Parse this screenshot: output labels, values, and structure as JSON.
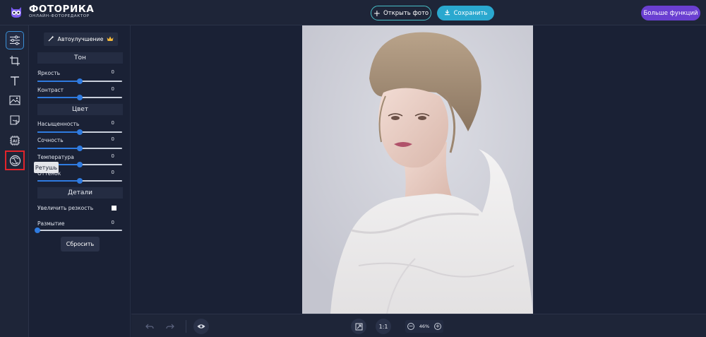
{
  "brand": {
    "name": "ФОТОРИКА",
    "subtitle": "ОНЛАЙН-ФОТОРЕДАКТОР"
  },
  "header": {
    "open_label": "Открыть фото",
    "save_label": "Сохранить",
    "more_label": "Больше функций"
  },
  "toolbar": {
    "tools": [
      {
        "name": "adjust",
        "icon": "sliders-icon",
        "active": true
      },
      {
        "name": "crop",
        "icon": "crop-icon"
      },
      {
        "name": "text",
        "icon": "text-icon"
      },
      {
        "name": "image",
        "icon": "image-icon"
      },
      {
        "name": "sticker",
        "icon": "sticker-icon"
      },
      {
        "name": "ai",
        "icon": "ai-chip-icon"
      },
      {
        "name": "retouch",
        "icon": "retouch-icon",
        "highlighted": true
      }
    ],
    "tooltip": "Ретушь"
  },
  "panel": {
    "auto_label": "Автоулучшение",
    "sections": {
      "tone": "Тон",
      "color": "Цвет",
      "details": "Детали"
    },
    "sliders": [
      {
        "label": "Яркость",
        "value": "0",
        "level": 0.5
      },
      {
        "label": "Контраст",
        "value": "0",
        "level": 0.5
      },
      {
        "label": "Насыщенность",
        "value": "0",
        "level": 0.5
      },
      {
        "label": "Сочность",
        "value": "0",
        "level": 0.5
      },
      {
        "label": "Температура",
        "value": "0",
        "level": 0.5
      },
      {
        "label": "Оттенок",
        "value": "0",
        "level": 0.5
      },
      {
        "label": "Размытие",
        "value": "0",
        "level": 0.0
      }
    ],
    "sharpen_label": "Увеличить резкость",
    "sharpen_checked": false,
    "reset_label": "Сбросить"
  },
  "bottombar": {
    "actual_size_label": "1:1",
    "zoom_value": "46%"
  },
  "colors": {
    "accent_teal": "#2aa8cf",
    "accent_purple": "#6a3fd1",
    "slider_blue": "#2f7be0",
    "highlight_red": "#e0242b"
  }
}
